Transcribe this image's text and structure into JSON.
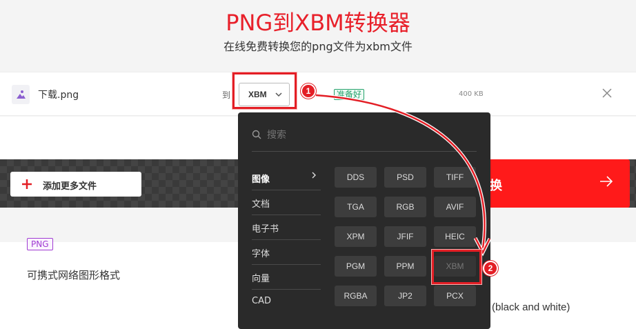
{
  "header": {
    "title": "PNG到XBM转换器",
    "subtitle": "在线免费转换您的png文件为xbm文件"
  },
  "file_row": {
    "file_name": "下载.png",
    "to_label": "到",
    "target_format": "XBM",
    "status": "准备好",
    "file_size": "400 KB",
    "file_icon": "image-icon",
    "close_icon": "close-icon"
  },
  "annotations": {
    "step1": "1",
    "step2": "2"
  },
  "action_bar": {
    "add_label": "添加更多文件",
    "convert_label": "换"
  },
  "dropdown": {
    "search_placeholder": "搜索",
    "categories": [
      {
        "label": "图像",
        "active": true
      },
      {
        "label": "文档"
      },
      {
        "label": "电子书"
      },
      {
        "label": "字体"
      },
      {
        "label": "向量"
      },
      {
        "label": "CAD"
      }
    ],
    "formats": [
      [
        "DDS",
        "PSD",
        "TIFF"
      ],
      [
        "TGA",
        "RGB",
        "AVIF"
      ],
      [
        "XPM",
        "JFIF",
        "HEIC"
      ],
      [
        "PGM",
        "PPM",
        "XBM"
      ],
      [
        "RGBA",
        "JP2",
        "PCX"
      ]
    ],
    "selected_format": "XBM"
  },
  "lower": {
    "tag": "PNG",
    "desc_left": "可携式网络图形格式",
    "desc_right": "(black and white)"
  },
  "colors": {
    "brand_red": "#e31e25",
    "status_green": "#24a26b",
    "tag_purple": "#a03bd2"
  }
}
